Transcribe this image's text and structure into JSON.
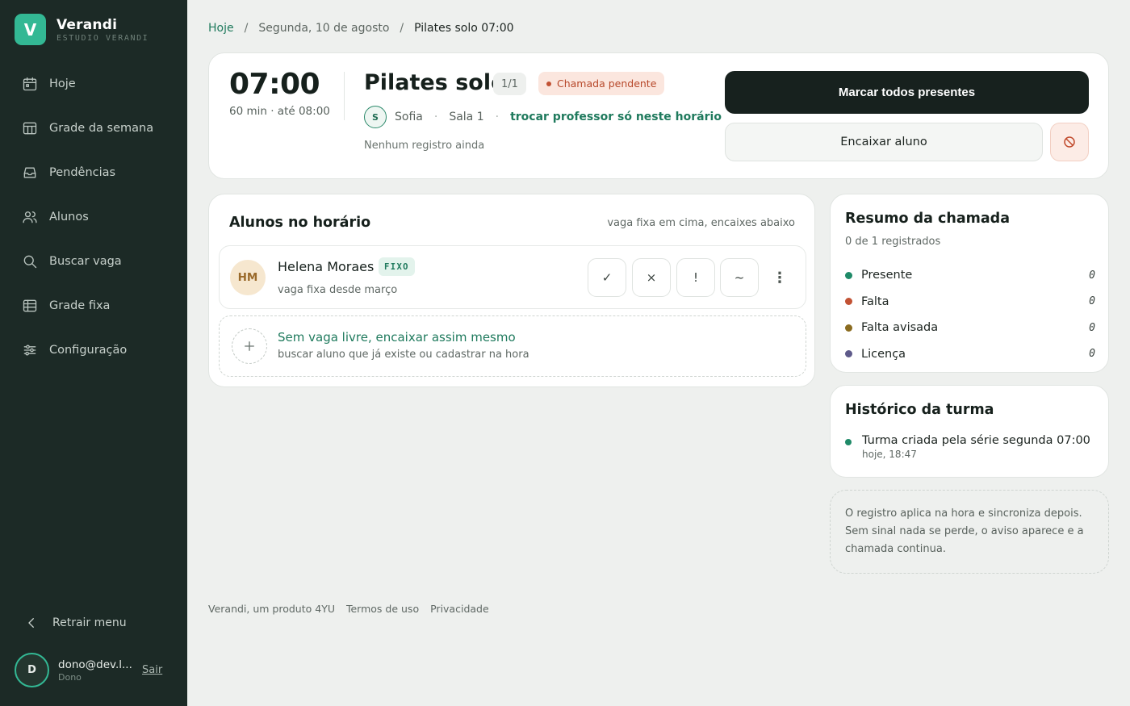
{
  "brand": {
    "logo_letter": "V",
    "name": "Verandi",
    "subtitle": "ESTUDIO VERANDI",
    "accent_color": "#33b894"
  },
  "sidebar": {
    "items": [
      {
        "label": "Hoje",
        "icon": "calendar-icon"
      },
      {
        "label": "Grade da semana",
        "icon": "week-grid-icon"
      },
      {
        "label": "Pendências",
        "icon": "inbox-icon"
      },
      {
        "label": "Alunos",
        "icon": "users-icon"
      },
      {
        "label": "Buscar vaga",
        "icon": "search-icon"
      },
      {
        "label": "Grade fixa",
        "icon": "table-icon"
      },
      {
        "label": "Configuração",
        "icon": "sliders-icon"
      }
    ],
    "collapse_label": "Retrair menu",
    "user": {
      "initial": "D",
      "email": "dono@dev.l...",
      "role": "Dono",
      "logout": "Sair"
    }
  },
  "breadcrumb": {
    "home": "Hoje",
    "date": "Segunda, 10 de agosto",
    "current": "Pilates solo 07:00"
  },
  "session": {
    "time": "07:00",
    "duration": "60 min · até 08:00",
    "title": "Pilates solo",
    "capacity": "1/1",
    "status": "Chamada pendente",
    "status_color": "#c25234",
    "teacher_initial": "S",
    "teacher": "Sofia",
    "room": "Sala 1",
    "change_teacher": "trocar professor só neste horário",
    "record_status": "Nenhum registro ainda",
    "mark_all": "Marcar todos presentes",
    "fit_student": "Encaixar aluno"
  },
  "students": {
    "title": "Alunos no horário",
    "note": "vaga fixa em cima, encaixes abaixo",
    "list": [
      {
        "initials": "HM",
        "name": "Helena Moraes",
        "badge": "FIXO",
        "sub": "vaga fixa desde março"
      }
    ],
    "attendance_buttons": [
      "✓",
      "×",
      "!",
      "~"
    ],
    "add": {
      "title": "Sem vaga livre, encaixar assim mesmo",
      "sub": "buscar aluno que já existe ou cadastrar na hora"
    }
  },
  "summary": {
    "title": "Resumo da chamada",
    "sub": "0 de 1 registrados",
    "items": [
      {
        "label": "Presente",
        "count": "0",
        "color": "#1f8a68"
      },
      {
        "label": "Falta",
        "count": "0",
        "color": "#c25234"
      },
      {
        "label": "Falta avisada",
        "count": "0",
        "color": "#8a6b1f"
      },
      {
        "label": "Licença",
        "count": "0",
        "color": "#5e5a8a"
      }
    ]
  },
  "history": {
    "title": "Histórico da turma",
    "items": [
      {
        "text": "Turma criada pela série segunda 07:00",
        "time": "hoje, 18:47"
      }
    ]
  },
  "info": {
    "line1": "O registro aplica na hora e sincroniza depois.",
    "line2": "Sem sinal nada se perde, o aviso aparece e a",
    "line3": "chamada continua."
  },
  "footer": {
    "product": "Verandi, um produto 4YU",
    "terms": "Termos de uso",
    "privacy": "Privacidade"
  }
}
